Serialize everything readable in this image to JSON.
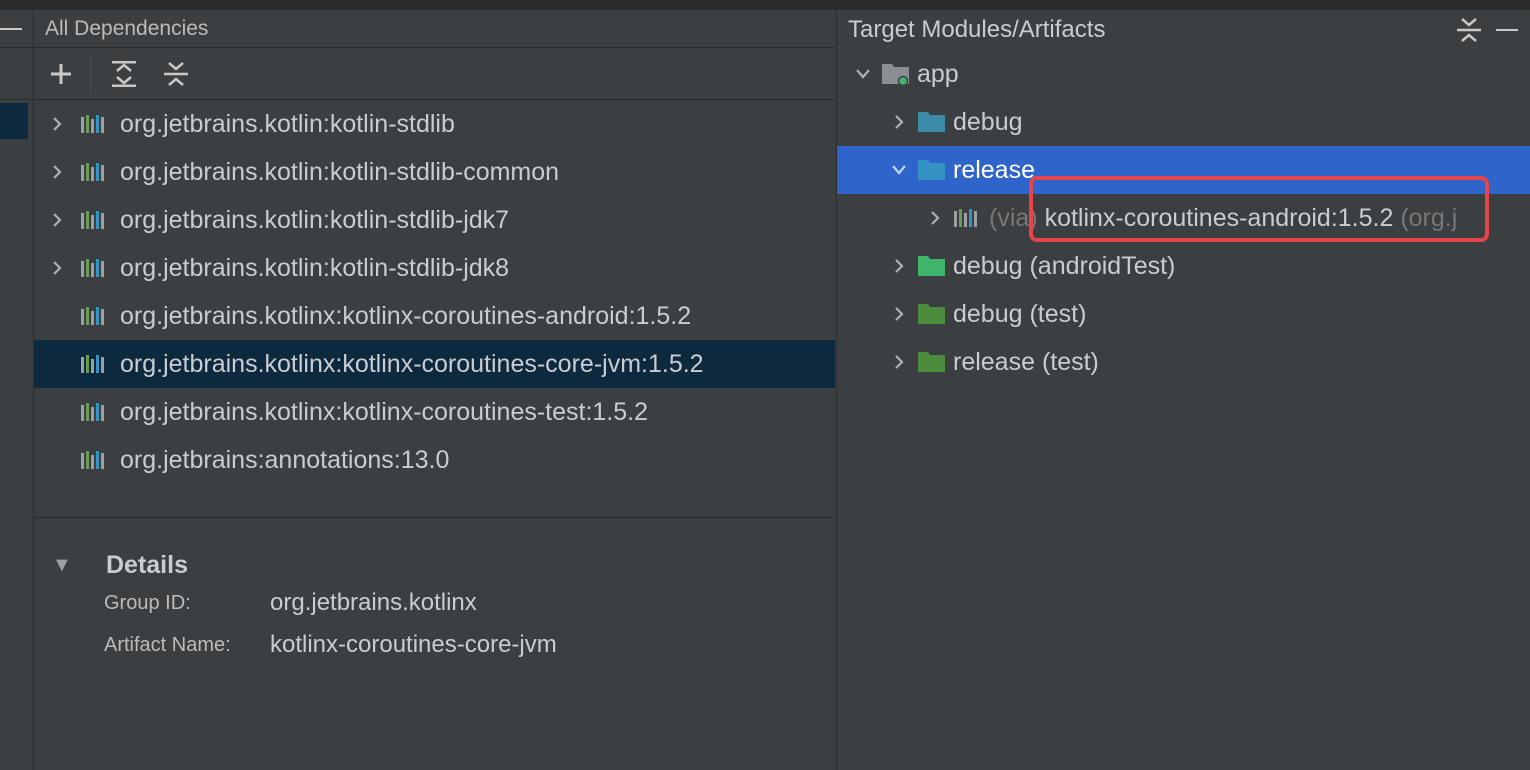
{
  "dependencies_panel": {
    "title": "All Dependencies",
    "toolbar": {
      "add_icon": "plus-icon",
      "expand_icon": "expand-all-icon",
      "collapse_icon": "collapse-all-icon"
    },
    "items": [
      {
        "label": "org.jetbrains.kotlin:kotlin-stdlib",
        "expandable": true,
        "selected": false
      },
      {
        "label": "org.jetbrains.kotlin:kotlin-stdlib-common",
        "expandable": true,
        "selected": false
      },
      {
        "label": "org.jetbrains.kotlin:kotlin-stdlib-jdk7",
        "expandable": true,
        "selected": false
      },
      {
        "label": "org.jetbrains.kotlin:kotlin-stdlib-jdk8",
        "expandable": true,
        "selected": false
      },
      {
        "label": "org.jetbrains.kotlinx:kotlinx-coroutines-android:1.5.2",
        "expandable": false,
        "selected": false
      },
      {
        "label": "org.jetbrains.kotlinx:kotlinx-coroutines-core-jvm:1.5.2",
        "expandable": false,
        "selected": true
      },
      {
        "label": "org.jetbrains.kotlinx:kotlinx-coroutines-test:1.5.2",
        "expandable": false,
        "selected": false
      },
      {
        "label": "org.jetbrains:annotations:13.0",
        "expandable": false,
        "selected": false
      }
    ]
  },
  "details": {
    "title": "Details",
    "group_id_label": "Group ID:",
    "group_id_value": "org.jetbrains.kotlinx",
    "artifact_name_label": "Artifact Name:",
    "artifact_name_value": "kotlinx-coroutines-core-jvm"
  },
  "targets_panel": {
    "title": "Target Modules/Artifacts",
    "tree": {
      "module": "app",
      "debug": "debug",
      "release": "release",
      "via_prefix": "(via)",
      "via_artifact": "kotlinx-coroutines-android:1.5.2",
      "via_suffix": "(org.j",
      "debug_android_test": "debug (androidTest)",
      "debug_test": "debug (test)",
      "release_test": "release (test)"
    }
  },
  "colors": {
    "selection_blue": "#2f65ca",
    "selection_dark": "#0d293e",
    "highlight_red": "#e5444b",
    "folder_blue": "#3592c4",
    "folder_teal": "#3b8aa8",
    "folder_green": "#3fb56b",
    "folder_green_dark": "#4c8c3c"
  }
}
